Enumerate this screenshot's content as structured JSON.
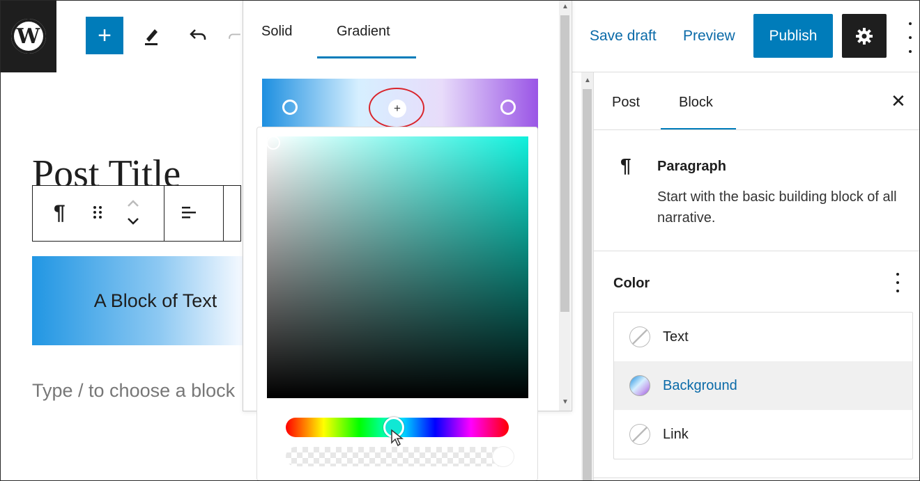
{
  "topbar": {
    "logo_text": "W",
    "add_label": "+",
    "save_draft": "Save draft",
    "preview": "Preview",
    "publish": "Publish"
  },
  "editor": {
    "post_title": "Post Title",
    "block_text": "A Block of Text",
    "placeholder": "Type / to choose a block"
  },
  "popover": {
    "tabs": [
      "Solid",
      "Gradient"
    ],
    "active_tab": "Gradient",
    "add_stop_label": "+",
    "accent": "#007cba",
    "selected_color": "#10f0dc"
  },
  "sidebar": {
    "tabs": [
      "Post",
      "Block"
    ],
    "active_tab": "Block",
    "close_label": "✕",
    "block_icon": "¶",
    "block_name": "Paragraph",
    "block_description": "Start with the basic building block of all narrative.",
    "color_section_title": "Color",
    "color_items": [
      {
        "label": "Text",
        "selected": false
      },
      {
        "label": "Background",
        "selected": true
      },
      {
        "label": "Link",
        "selected": false
      }
    ]
  }
}
